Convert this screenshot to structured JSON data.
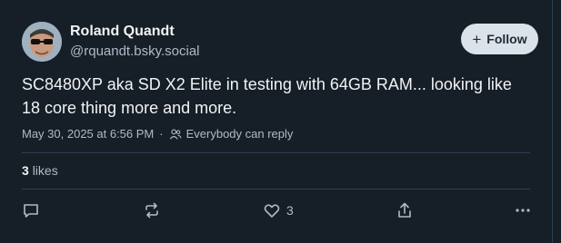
{
  "author": {
    "display_name": "Roland Quandt",
    "handle": "@rquandt.bsky.social",
    "avatar_icon": "avatar-person-sunglasses"
  },
  "follow": {
    "label": "Follow",
    "icon": "plus-icon"
  },
  "post": {
    "text": "SC8480XP aka SD X2 Elite in testing with 64GB RAM... looking like 18 core thing more and more.",
    "timestamp": "May 30, 2025 at 6:56 PM",
    "reply_setting": "Everybody can reply"
  },
  "stats": {
    "likes_count": "3",
    "likes_label": "likes"
  },
  "actions": {
    "reply_icon": "reply-icon",
    "repost_icon": "repost-icon",
    "like_icon": "heart-icon",
    "like_count": "3",
    "share_icon": "share-icon",
    "more_icon": "more-icon"
  },
  "colors": {
    "background": "#161e27",
    "text": "#f1f3f5",
    "muted": "#aebbc9",
    "border": "#2e4052",
    "follow_bg": "#dce2ea"
  }
}
